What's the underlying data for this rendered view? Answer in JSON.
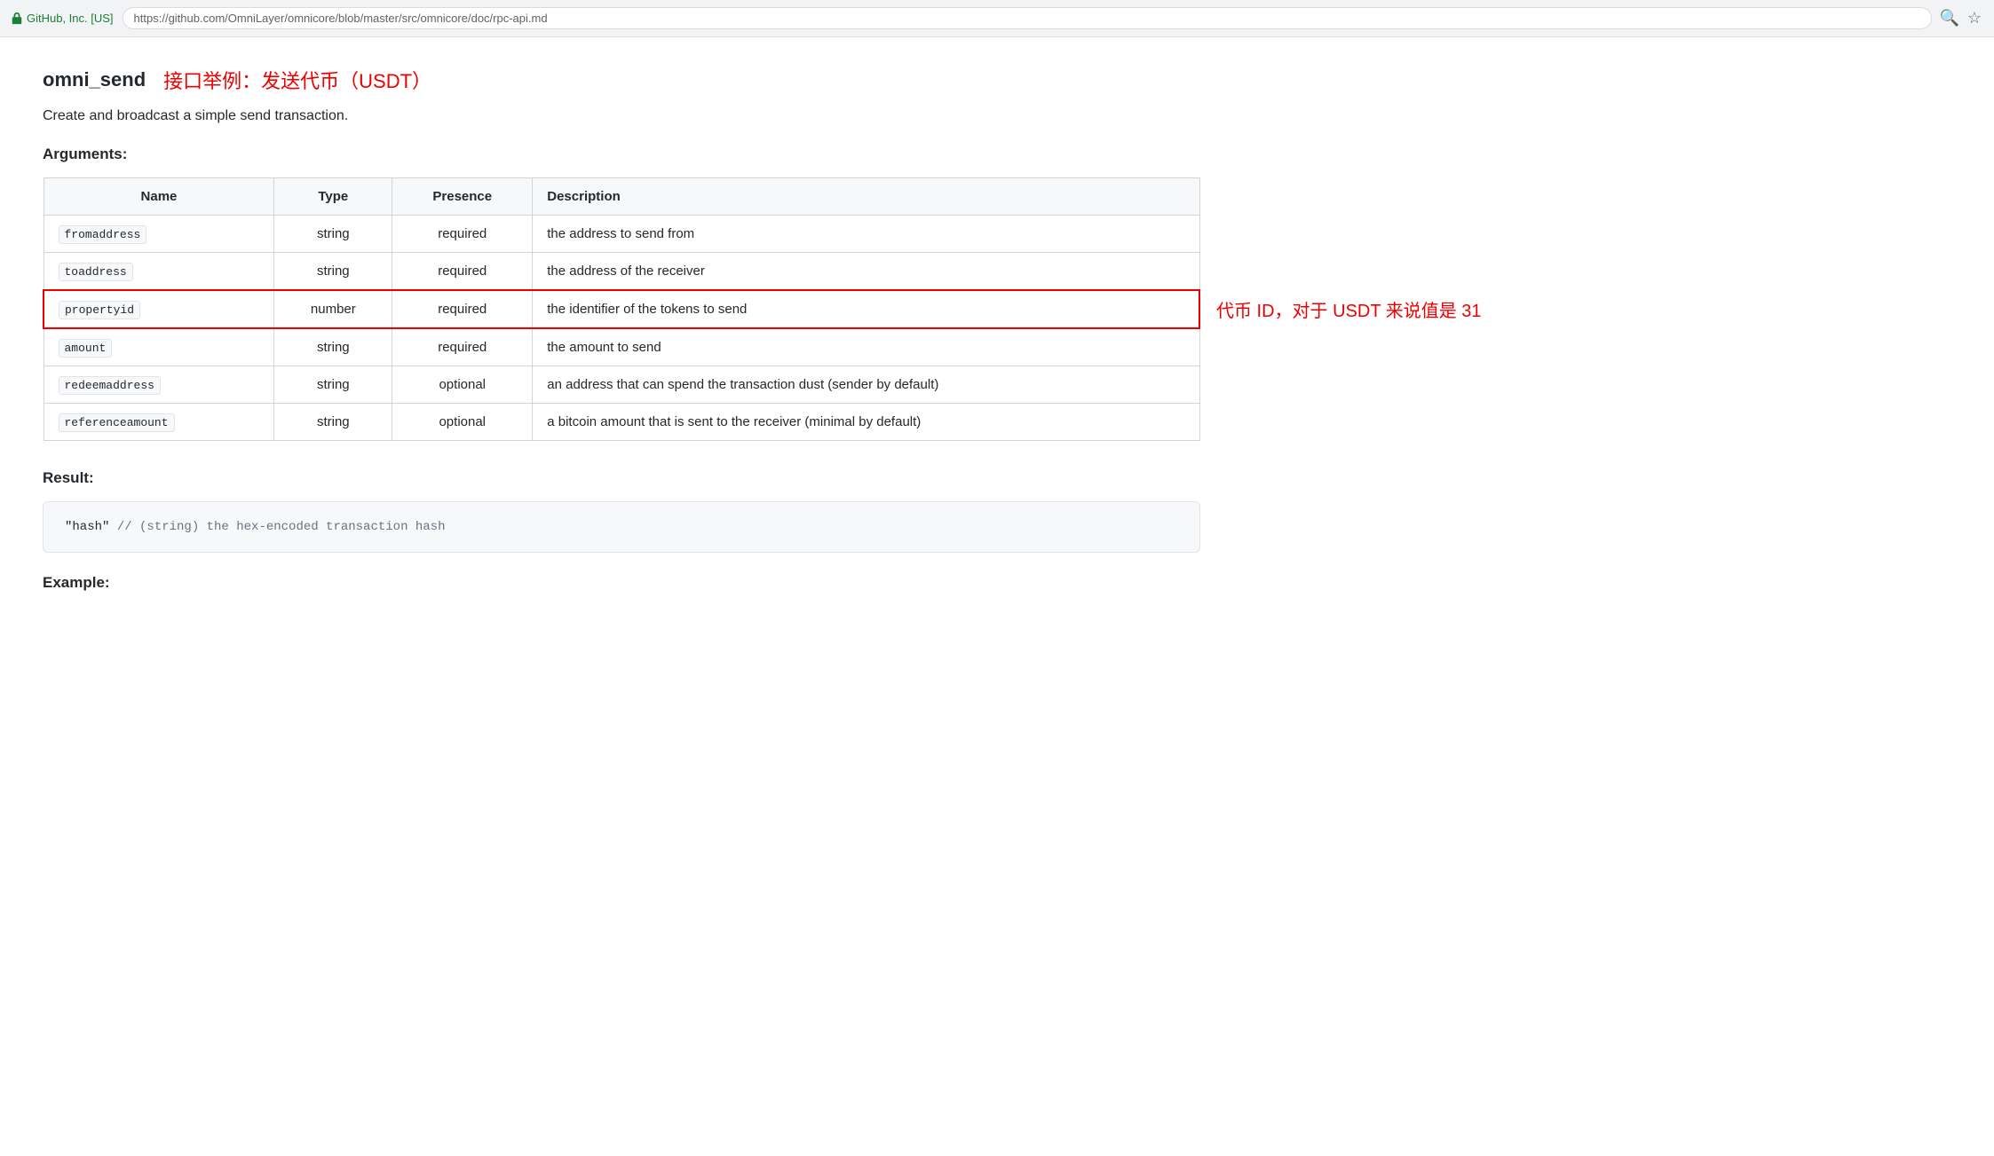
{
  "browser": {
    "security_label": "GitHub, Inc. [US]",
    "url_full": "https://github.com/OmniLayer/omnicore/blob/master/src/omnicore/doc/rpc-api.md",
    "url_origin": "GitHub, Inc. [US] | https://github.com/OmniLayer/omnicore/blob/master/src/omnicore/doc/rpc-api.md",
    "search_icon": "🔍",
    "star_icon": "☆"
  },
  "page": {
    "func_name": "omni_send",
    "chinese_subtitle": "接口举例：发送代币（USDT）",
    "description": "Create and broadcast a simple send transaction.",
    "arguments_label": "Arguments:",
    "result_label": "Result:",
    "example_label": "Example:",
    "table": {
      "headers": [
        "Name",
        "Type",
        "Presence",
        "Description"
      ],
      "rows": [
        {
          "name": "fromaddress",
          "type": "string",
          "presence": "required",
          "description": "the address to send from",
          "highlighted": false
        },
        {
          "name": "toaddress",
          "type": "string",
          "presence": "required",
          "description": "the address of the receiver",
          "highlighted": false
        },
        {
          "name": "propertyid",
          "type": "number",
          "presence": "required",
          "description": "the identifier of the tokens to send",
          "highlighted": true,
          "annotation": "代币 ID，对于 USDT 来说值是 31"
        },
        {
          "name": "amount",
          "type": "string",
          "presence": "required",
          "description": "the amount to send",
          "highlighted": false
        },
        {
          "name": "redeemaddress",
          "type": "string",
          "presence": "optional",
          "description": "an address that can spend the transaction dust (sender by default)",
          "highlighted": false
        },
        {
          "name": "referenceamount",
          "type": "string",
          "presence": "optional",
          "description": "a bitcoin amount that is sent to the receiver (minimal by default)",
          "highlighted": false
        }
      ]
    },
    "result_code": "\"hash\"  // (string) the hex-encoded transaction hash"
  }
}
